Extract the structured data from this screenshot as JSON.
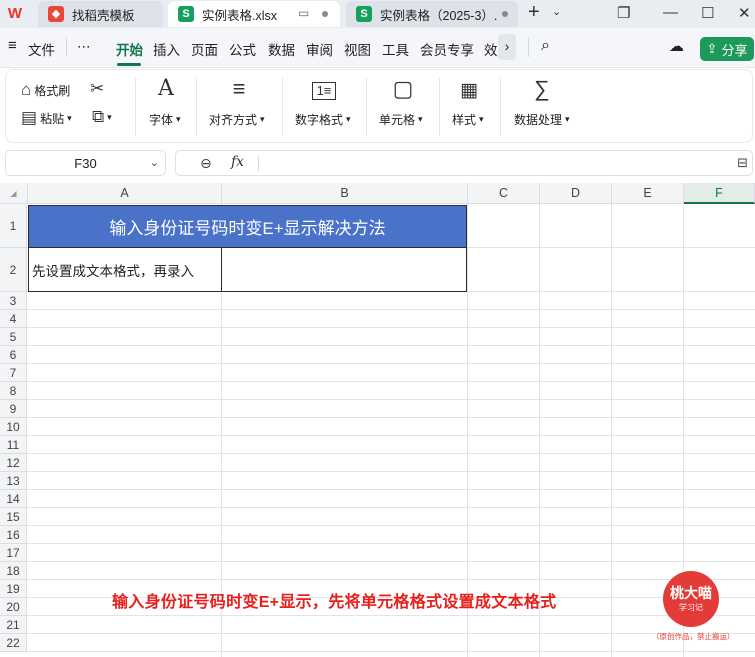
{
  "tabs": [
    {
      "label": "找稻壳模板",
      "icon": "docer-icon"
    },
    {
      "label": "实例表格.xlsx",
      "icon": "sheet-icon"
    },
    {
      "label": "实例表格（2025-3）.",
      "icon": "sheet-icon"
    }
  ],
  "menu": {
    "file": "文件",
    "more": "⋯",
    "items": [
      "开始",
      "插入",
      "页面",
      "公式",
      "数据",
      "审阅",
      "视图",
      "工具",
      "会员专享",
      "效"
    ],
    "share": "分享"
  },
  "ribbon": {
    "format_painter": "格式刷",
    "paste": "粘贴",
    "font": "字体",
    "align": "对齐方式",
    "number_format": "数字格式",
    "cell": "单元格",
    "style": "样式",
    "data_process": "数据处理"
  },
  "formula_bar": {
    "name_box": "F30",
    "fx": "fx",
    "value": ""
  },
  "sheet": {
    "columns": [
      "A",
      "B",
      "C",
      "D",
      "E",
      "F"
    ],
    "rows": [
      "1",
      "2",
      "3",
      "4",
      "5",
      "6",
      "7",
      "8",
      "9",
      "10",
      "11",
      "12",
      "13",
      "14",
      "15",
      "16",
      "17",
      "18",
      "19",
      "20",
      "21",
      "22"
    ],
    "a1": "输入身份证号码时变E+显示解决方法",
    "a2": "先设置成文本格式，再录入",
    "b2": ""
  },
  "overlay": {
    "note": "输入身份证号码时变E+显示，先将单元格格式设置成文本格式",
    "stamp_name": "桃大喵",
    "stamp_sub": "学习记",
    "stamp_note": "（原创作品，禁止搬运）"
  },
  "colors": {
    "accent": "#11774a",
    "title_fill": "#4a72c9",
    "note_red": "#e8201c"
  }
}
